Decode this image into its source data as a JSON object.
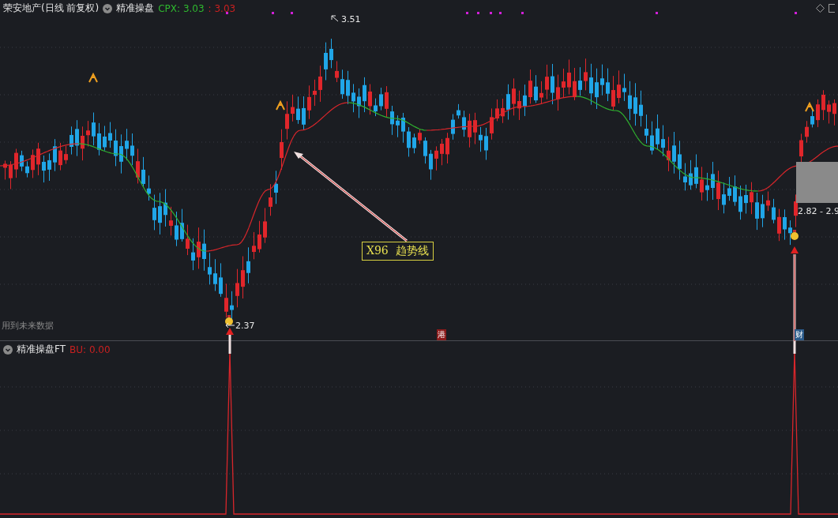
{
  "main_panel": {
    "stock_title": "荣安地产(日线 前复权)",
    "indicator_name": "精准操盘",
    "value_label": "CPX: 3.03",
    "value_secondary": ": 3.03"
  },
  "chart_labels": {
    "high_price": "3.51",
    "low_price": "2.37",
    "annotation": "X96  趋势线",
    "warning": "用到未来数据",
    "price_range": "2.82 - 2.9",
    "marker_left": "港",
    "marker_right": "财"
  },
  "lower_panel": {
    "indicator_name": "精准操盘FT",
    "value_label": "BU: 0.00"
  }
}
